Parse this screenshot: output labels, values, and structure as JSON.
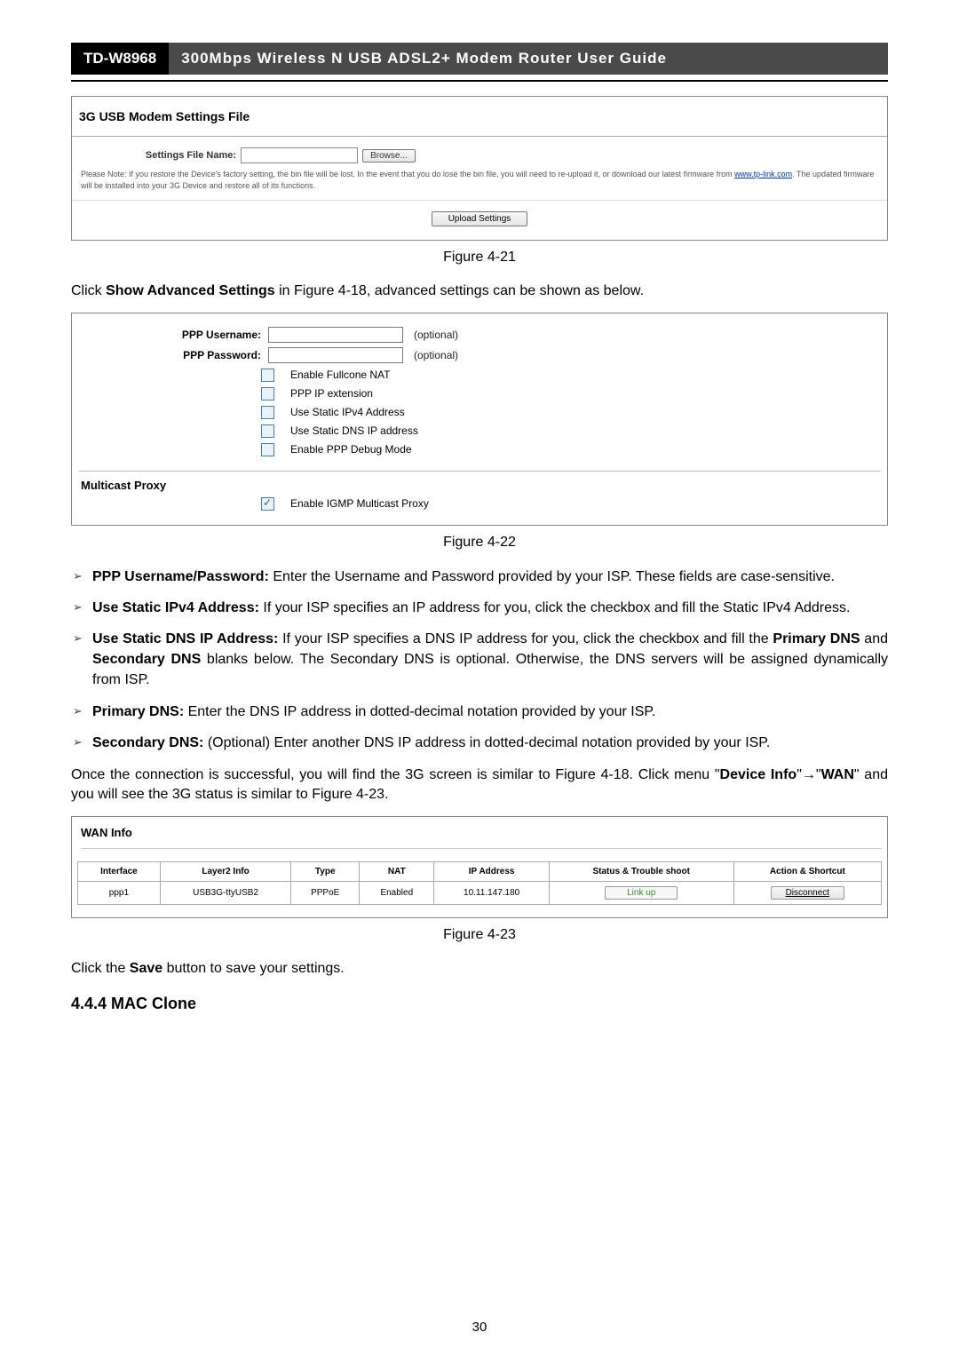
{
  "header": {
    "model": "TD-W8968",
    "title": "300Mbps Wireless N USB ADSL2+ Modem Router User Guide"
  },
  "usb_box": {
    "title": "3G USB Modem Settings File",
    "label": "Settings File Name:",
    "browse": "Browse...",
    "hint1": "Please Note: If you restore the Device's factory setting, the bin file will be lost. In the event that you do lose the bin file, you will need to re-upload it, or download our latest firmware from ",
    "hint_link": "www.tp-link.com",
    "hint2": ". The updated firmware will be installed into your 3G Device and restore all of its functions.",
    "upload": "Upload Settings"
  },
  "captions": {
    "fig21": "Figure 4-21",
    "fig22": "Figure 4-22",
    "fig23": "Figure 4-23"
  },
  "p1_a": "Click ",
  "p1_b": "Show Advanced Settings",
  "p1_c": " in Figure 4-18, advanced settings can be shown as below.",
  "adv": {
    "ppp_user_label": "PPP Username:",
    "ppp_pass_label": "PPP Password:",
    "optional": "(optional)",
    "chk1": "Enable Fullcone NAT",
    "chk2": "PPP IP extension",
    "chk3": "Use Static IPv4 Address",
    "chk4": "Use Static DNS IP address",
    "chk5": "Enable PPP Debug Mode",
    "multicast_title": "Multicast Proxy",
    "chk6": "Enable IGMP Multicast Proxy"
  },
  "bullets": {
    "b1_strong": "PPP Username/Password:",
    "b1_text": " Enter the Username and Password provided by your ISP. These fields are case-sensitive.",
    "b2_strong": "Use Static IPv4 Address:",
    "b2_text": " If your ISP specifies an IP address for you, click the checkbox and fill the Static IPv4 Address.",
    "b3_strong": "Use Static DNS IP Address:",
    "b3_text_a": " If your ISP specifies a DNS IP address for you, click the checkbox and fill the ",
    "b3_pd": "Primary DNS",
    "b3_and": " and ",
    "b3_sd": "Secondary DNS",
    "b3_text_b": " blanks below. The Secondary DNS is optional. Otherwise, the DNS servers will be assigned dynamically from ISP.",
    "b4_strong": "Primary DNS:",
    "b4_text": " Enter the DNS IP address in dotted-decimal notation provided by your ISP.",
    "b5_strong": "Secondary DNS:",
    "b5_text": " (Optional) Enter another DNS IP address in dotted-decimal notation provided by your ISP."
  },
  "p2_a": "Once the connection is successful, you will find the 3G screen is similar to Figure 4-18. Click menu \"",
  "p2_b": "Device Info",
  "p2_arrow": "→",
  "p2_c": "WAN",
  "p2_d": "\" and you will see the 3G status is similar to Figure 4-23.",
  "wan": {
    "title": "WAN Info",
    "th": [
      "Interface",
      "Layer2 Info",
      "Type",
      "NAT",
      "IP Address",
      "Status & Trouble shoot",
      "Action & Shortcut"
    ],
    "row": {
      "iface": "ppp1",
      "l2": "USB3G-ttyUSB2",
      "type": "PPPoE",
      "nat": "Enabled",
      "ip": "10.11.147.180",
      "status": "Link up",
      "action": "Disconnect"
    }
  },
  "p3_a": "Click the ",
  "p3_b": "Save",
  "p3_c": " button to save your settings.",
  "sec_head": "4.4.4  MAC Clone",
  "page_num": "30"
}
